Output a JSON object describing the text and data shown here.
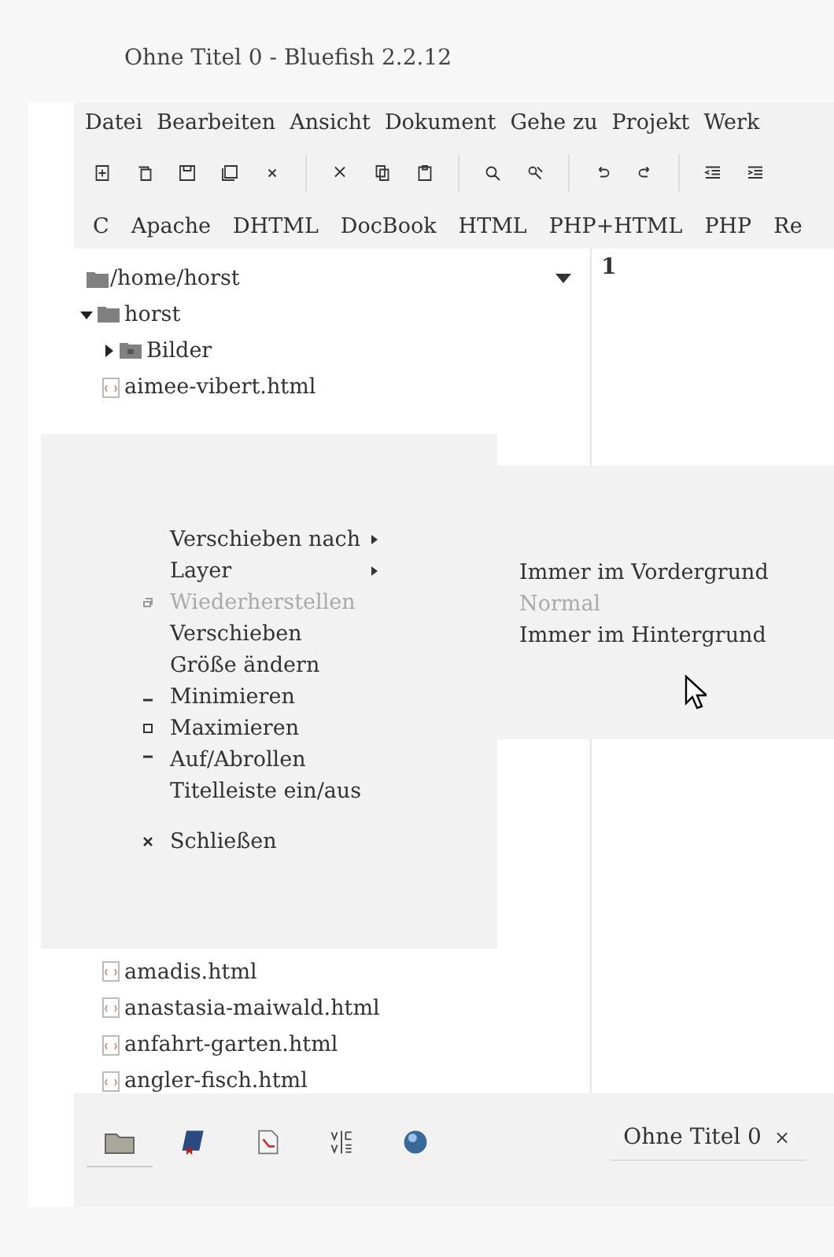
{
  "window": {
    "title": "Ohne Titel 0 - Bluefish 2.2.12"
  },
  "menu_bar": [
    "Datei",
    "Bearbeiten",
    "Ansicht",
    "Dokument",
    "Gehe zu",
    "Projekt",
    "Werk"
  ],
  "language_bar": [
    "C",
    "Apache",
    "DHTML",
    "DocBook",
    "HTML",
    "PHP+HTML",
    "PHP",
    "Re"
  ],
  "file_panel": {
    "path": "/home/horst",
    "tree": [
      {
        "name": "horst",
        "kind": "folder",
        "expanded": true,
        "children": [
          {
            "name": "Bilder",
            "kind": "folder",
            "expanded": false
          },
          {
            "name": "aimee-vibert.html",
            "kind": "file"
          },
          {
            "name": "amadis.html",
            "kind": "file"
          },
          {
            "name": "anastasia-maiwald.html",
            "kind": "file"
          },
          {
            "name": "anfahrt-garten.html",
            "kind": "file"
          },
          {
            "name": "angler-fisch.html",
            "kind": "file"
          }
        ]
      }
    ]
  },
  "editor": {
    "line_numbers": [
      "1"
    ]
  },
  "window_menu": {
    "items": [
      {
        "kind": "submenu",
        "label": "Verschieben nach",
        "disabled": false
      },
      {
        "kind": "submenu",
        "label": "Layer",
        "disabled": false
      },
      {
        "kind": "restore",
        "label": "Wiederherstellen",
        "disabled": true
      },
      {
        "kind": "plain",
        "label": "Verschieben",
        "disabled": false
      },
      {
        "kind": "plain",
        "label": "Größe ändern",
        "disabled": false
      },
      {
        "kind": "minimize",
        "label": "Minimieren",
        "disabled": false
      },
      {
        "kind": "maximize",
        "label": "Maximieren",
        "disabled": false
      },
      {
        "kind": "shade",
        "label": "Auf/Abrollen",
        "disabled": false
      },
      {
        "kind": "plain",
        "label": "Titelleiste ein/aus",
        "disabled": false
      },
      {
        "kind": "spacer"
      },
      {
        "kind": "close",
        "label": "Schließen",
        "disabled": false
      }
    ]
  },
  "layer_submenu": {
    "items": [
      {
        "label": "Immer im Vordergrund",
        "disabled": false
      },
      {
        "label": "Normal",
        "disabled": true
      },
      {
        "label": "Immer im Hintergrund",
        "disabled": false
      }
    ]
  },
  "side_tabs": [
    {
      "kind": "files",
      "selected": true
    },
    {
      "kind": "bookmarks",
      "selected": false
    },
    {
      "kind": "reference",
      "selected": false
    },
    {
      "kind": "charmap",
      "selected": false
    },
    {
      "kind": "snippets",
      "selected": false
    }
  ],
  "document_tabs": [
    {
      "label": "Ohne Titel 0",
      "close": "×",
      "selected": true
    }
  ]
}
